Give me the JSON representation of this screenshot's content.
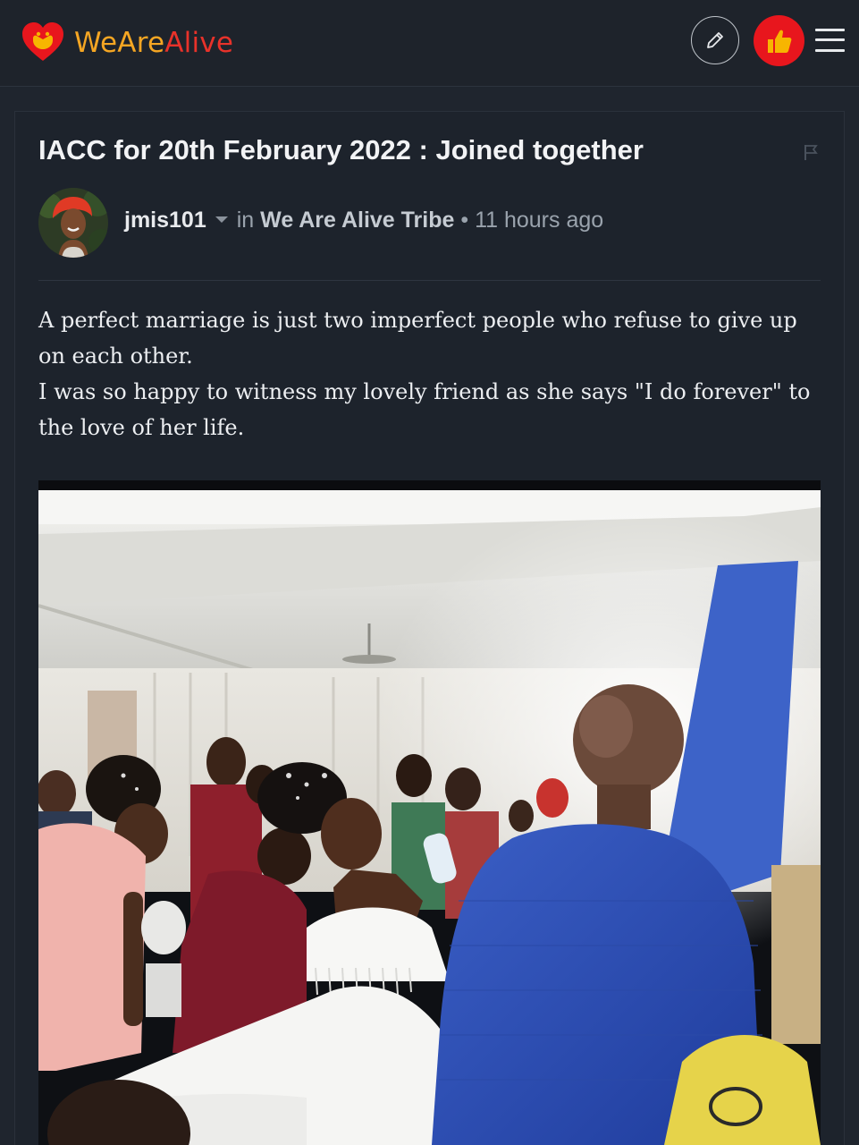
{
  "header": {
    "logo_we": "WeAre",
    "logo_alive": "Alive",
    "edit_icon": "pencil-icon",
    "like_icon": "thumbs-up-icon",
    "menu_icon": "hamburger-icon",
    "colors": {
      "brand_orange": "#f5a623",
      "brand_red": "#e8322a",
      "like_red": "#e8161d"
    }
  },
  "post": {
    "title": "IACC for 20th February 2022 : Joined together",
    "author": "jmis101",
    "in_label": "in",
    "community": "We Are Alive Tribe",
    "separator": "•",
    "time_ago": "11 hours ago",
    "paragraphs": [
      "A perfect marriage is just two imperfect people who refuse to give up on each other.",
      "I was so happy to witness my lovely friend as she says \"I do forever\" to the love of her life."
    ]
  }
}
